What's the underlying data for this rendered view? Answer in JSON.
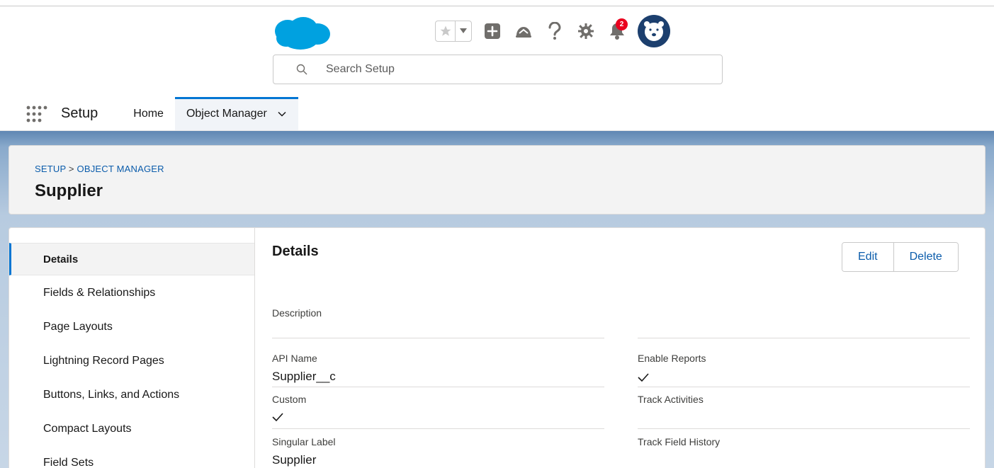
{
  "header": {
    "search": {
      "placeholder": "Search Setup"
    },
    "notifications": {
      "count": "2"
    },
    "icons": {
      "logo": "salesforce-cloud-logo",
      "favorites": "star-icon",
      "favorites_menu": "caret-down-icon",
      "add": "plus-box-icon",
      "trailhead": "trailhead-icon",
      "help": "question-icon",
      "settings": "gear-icon",
      "notifications": "bell-icon",
      "avatar": "bear-avatar"
    },
    "colors": {
      "brand": "#00a1e0",
      "badge": "#ea001e",
      "avatar_bg": "#1c3f6e"
    }
  },
  "nav": {
    "app_name": "Setup",
    "tabs": [
      {
        "label": "Home"
      },
      {
        "label": "Object Manager"
      }
    ],
    "active_tab": "Object Manager"
  },
  "page_header": {
    "breadcrumb": {
      "root": "SETUP",
      "separator": ">",
      "current": "OBJECT MANAGER"
    },
    "title": "Supplier"
  },
  "sidebar": {
    "items": [
      {
        "label": "Details"
      },
      {
        "label": "Fields & Relationships"
      },
      {
        "label": "Page Layouts"
      },
      {
        "label": "Lightning Record Pages"
      },
      {
        "label": "Buttons, Links, and Actions"
      },
      {
        "label": "Compact Layouts"
      },
      {
        "label": "Field Sets"
      }
    ],
    "active": "Details"
  },
  "details": {
    "title": "Details",
    "edit_label": "Edit",
    "delete_label": "Delete",
    "left": [
      {
        "label": "Description",
        "value": ""
      },
      {
        "label": "API Name",
        "value": "Supplier__c"
      },
      {
        "label": "Custom",
        "value": "✓"
      },
      {
        "label": "Singular Label",
        "value": "Supplier"
      }
    ],
    "right": [
      {
        "label": "",
        "value": ""
      },
      {
        "label": "Enable Reports",
        "value": "✓"
      },
      {
        "label": "Track Activities",
        "value": ""
      },
      {
        "label": "Track Field History",
        "value": ""
      }
    ]
  }
}
